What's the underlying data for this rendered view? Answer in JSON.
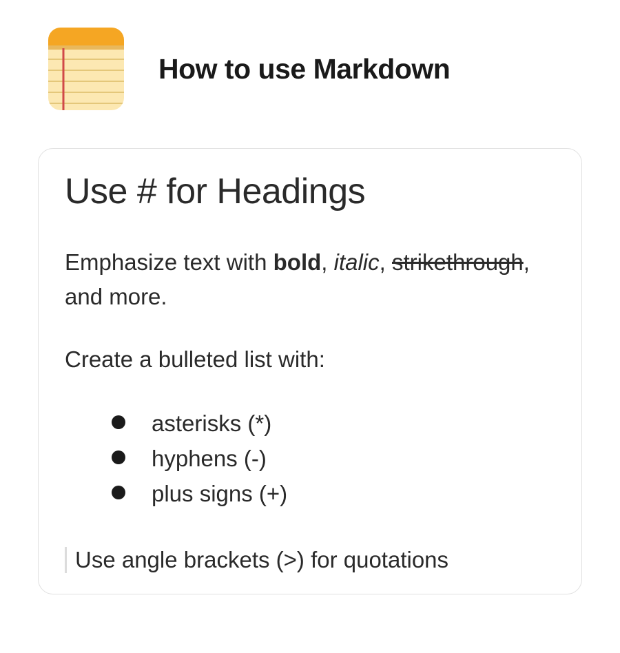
{
  "header": {
    "title": "How to use Markdown",
    "icon": "notepad-icon"
  },
  "card": {
    "heading": "Use # for Headings",
    "emphasis": {
      "prefix": "Emphasize text with ",
      "bold": "bold",
      "sep1": ", ",
      "italic": "italic",
      "sep2": ", ",
      "strike": "strikethrough",
      "suffix": ", and more."
    },
    "list_intro": "Create a bulleted list with:",
    "bullets": [
      "asterisks (*)",
      "hyphens (-)",
      "plus signs (+)"
    ],
    "blockquote": "Use angle brackets (>) for quotations"
  }
}
